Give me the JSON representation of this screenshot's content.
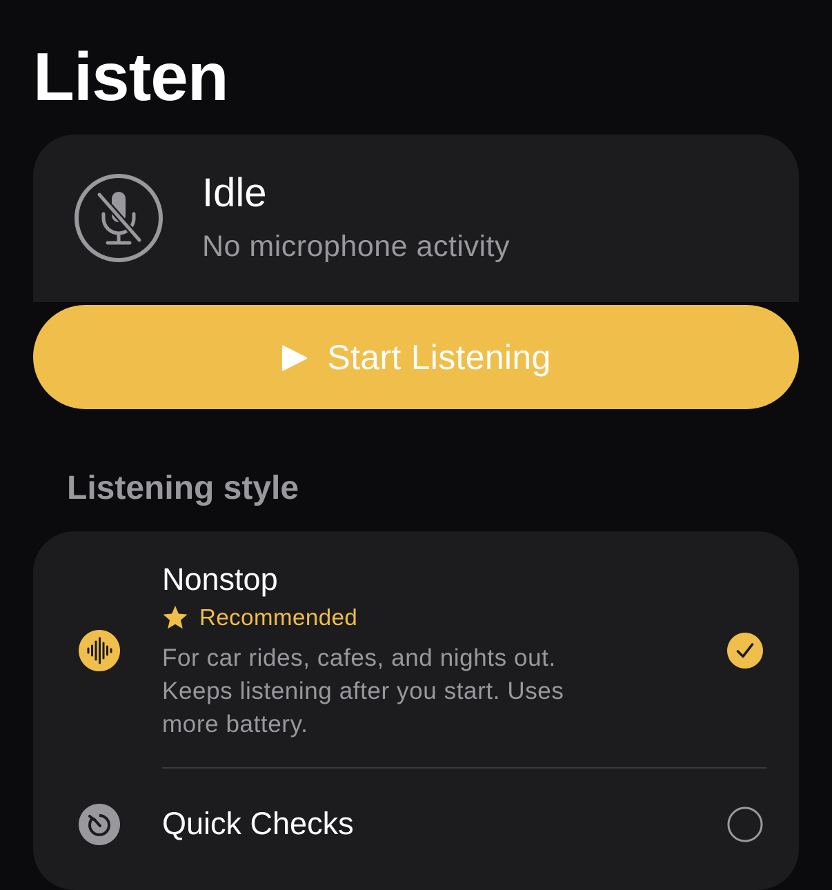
{
  "page": {
    "title": "Listen"
  },
  "status": {
    "title": "Idle",
    "subtitle": "No microphone activity",
    "icon": "mic-off-icon"
  },
  "start_button": {
    "label": "Start Listening",
    "icon": "play-icon"
  },
  "listening_style": {
    "section_title": "Listening style",
    "options": [
      {
        "title": "Nonstop",
        "badge": "Recommended",
        "description": "For car rides, cafes, and nights out. Keeps listening after you start. Uses more battery.",
        "icon": "waveform-icon",
        "selected": true
      },
      {
        "title": "Quick Checks",
        "icon": "timer-icon",
        "selected": false
      }
    ]
  },
  "colors": {
    "background": "#0b0b0d",
    "card": "#1c1c1e",
    "accent": "#f0be4b",
    "secondary_text": "#98989d",
    "divider": "#3a3a3c"
  }
}
